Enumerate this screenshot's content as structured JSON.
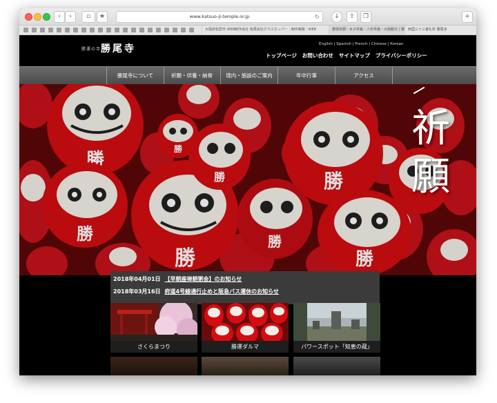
{
  "browser": {
    "url": "www.katsuo-ji-temple.or.jp",
    "tabs": [
      "大阪府松原市 WEB制作会社 有限会社グラスホッパー｜制作実績｜WEB",
      "勝運祈願・水子供養・人形供養・大阪観光 | 勝尾寺",
      "西国三十三番札所 勝尾寺"
    ]
  },
  "site": {
    "logo_prefix": "勝運の寺",
    "logo_name": "勝尾寺",
    "languages": "English | Spanish | French | Chinese | Korean",
    "top_links": [
      "トップページ",
      "お問い合わせ",
      "サイトマップ",
      "プライバシーポリシー"
    ],
    "nav": [
      "勝尾寺について",
      "祈願・供養・納骨",
      "境内・施設のご案内",
      "年中行事",
      "アクセス"
    ]
  },
  "hero": {
    "title_line1": "祈",
    "title_line2": "願"
  },
  "news": [
    {
      "date": "2018年04月01日",
      "text": "【早朝座禅朝粥会】のお知らせ"
    },
    {
      "date": "2018年03月16日",
      "text": "府道4号線通行止めと阪急バス運休のお知らせ"
    }
  ],
  "tiles": [
    {
      "caption": "さくらまつり"
    },
    {
      "caption": "勝運ダルマ"
    },
    {
      "caption": "パワースポット「知恵の蔵」"
    }
  ],
  "colors": {
    "accent": "#d40d12",
    "nav_bg": "#5a5a5a",
    "news_bg": "#3b3b3b"
  }
}
